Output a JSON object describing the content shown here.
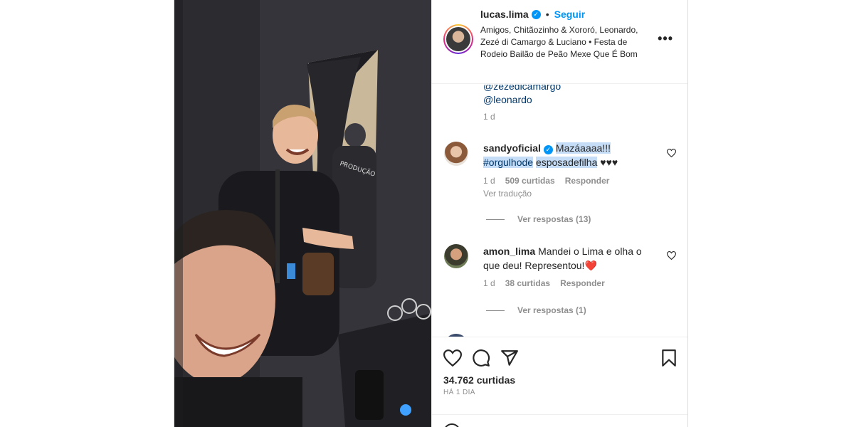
{
  "post": {
    "username": "lucas.lima",
    "separator": "•",
    "follow_label": "Seguir",
    "location": "Amigos, Chitãozinho & Xororó, Leonardo, Zezé di Camargo & Luciano • Festa de Rodeio Bailão de Peão Mexe Que É Bom",
    "more_icon": "•••",
    "verified_icon": "✓"
  },
  "caption_tail": {
    "mention1": "@zezedicamargo",
    "mention2": "@leonardo",
    "age": "1 d"
  },
  "comments": [
    {
      "username": "sandyoficial",
      "text_highlight_1": "Mazáaaaa!!!",
      "hashtag": "#orgulhode",
      "text_highlight_2": "esposadefilha",
      "hearts": "♥♥♥",
      "age": "1 d",
      "likes": "509 curtidas",
      "reply": "Responder",
      "translate": "Ver tradução",
      "view_replies": "Ver respostas (13)"
    },
    {
      "username": "amon_lima",
      "text": "Mandei o Lima e olha o que deu! Representou!",
      "emoji": "❤️",
      "age": "1 d",
      "likes": "38 curtidas",
      "reply": "Responder",
      "view_replies": "Ver respostas (1)"
    }
  ],
  "footer": {
    "likes": "34.762 curtidas",
    "age": "HÁ 1 DIA"
  },
  "icons": [
    "heart-icon",
    "comment-icon",
    "share-icon",
    "bookmark-icon",
    "more-options-icon",
    "verified-icon",
    "emoji-icon"
  ],
  "colors": {
    "accent": "#0095f6",
    "link": "#00376b",
    "muted": "#8e8e8e",
    "text": "#262626",
    "highlight": "#c5ddf7"
  }
}
